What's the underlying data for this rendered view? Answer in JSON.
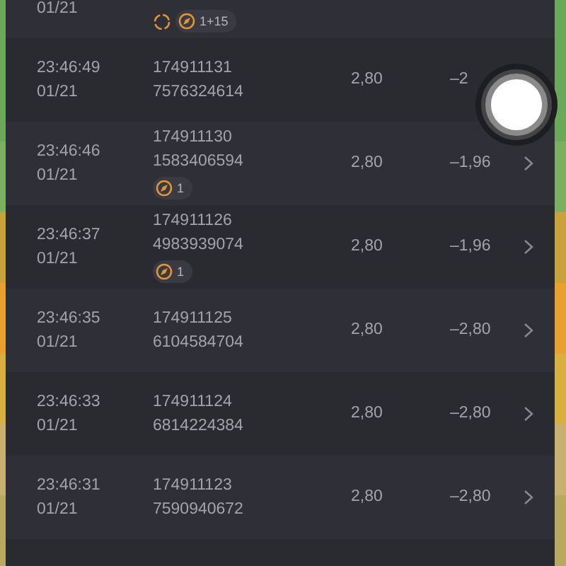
{
  "rows": [
    {
      "kind": "partial",
      "date": "01/21",
      "badges": [
        {
          "kind": "spinner"
        },
        {
          "kind": "count",
          "count": "1+15"
        }
      ]
    },
    {
      "kind": "full",
      "time": "23:46:49",
      "date": "01/21",
      "id": "174911131",
      "code": "7576324614",
      "price": "2,80",
      "amount": "–2",
      "chevron": false,
      "badges": []
    },
    {
      "kind": "full",
      "time": "23:46:46",
      "date": "01/21",
      "id": "174911130",
      "code": "1583406594",
      "price": "2,80",
      "amount": "–1,96",
      "chevron": true,
      "badges": [
        {
          "kind": "count",
          "count": "1"
        }
      ]
    },
    {
      "kind": "full",
      "time": "23:46:37",
      "date": "01/21",
      "id": "174911126",
      "code": "4983939074",
      "price": "2,80",
      "amount": "–1,96",
      "chevron": true,
      "badges": [
        {
          "kind": "count",
          "count": "1"
        }
      ]
    },
    {
      "kind": "full",
      "time": "23:46:35",
      "date": "01/21",
      "id": "174911125",
      "code": "6104584704",
      "price": "2,80",
      "amount": "–2,80",
      "chevron": true,
      "badges": []
    },
    {
      "kind": "full",
      "time": "23:46:33",
      "date": "01/21",
      "id": "174911124",
      "code": "6814224384",
      "price": "2,80",
      "amount": "–2,80",
      "chevron": true,
      "badges": []
    },
    {
      "kind": "full",
      "time": "23:46:31",
      "date": "01/21",
      "id": "174911123",
      "code": "7590940672",
      "price": "2,80",
      "amount": "–2,80",
      "chevron": true,
      "badges": []
    },
    {
      "kind": "empty"
    }
  ]
}
